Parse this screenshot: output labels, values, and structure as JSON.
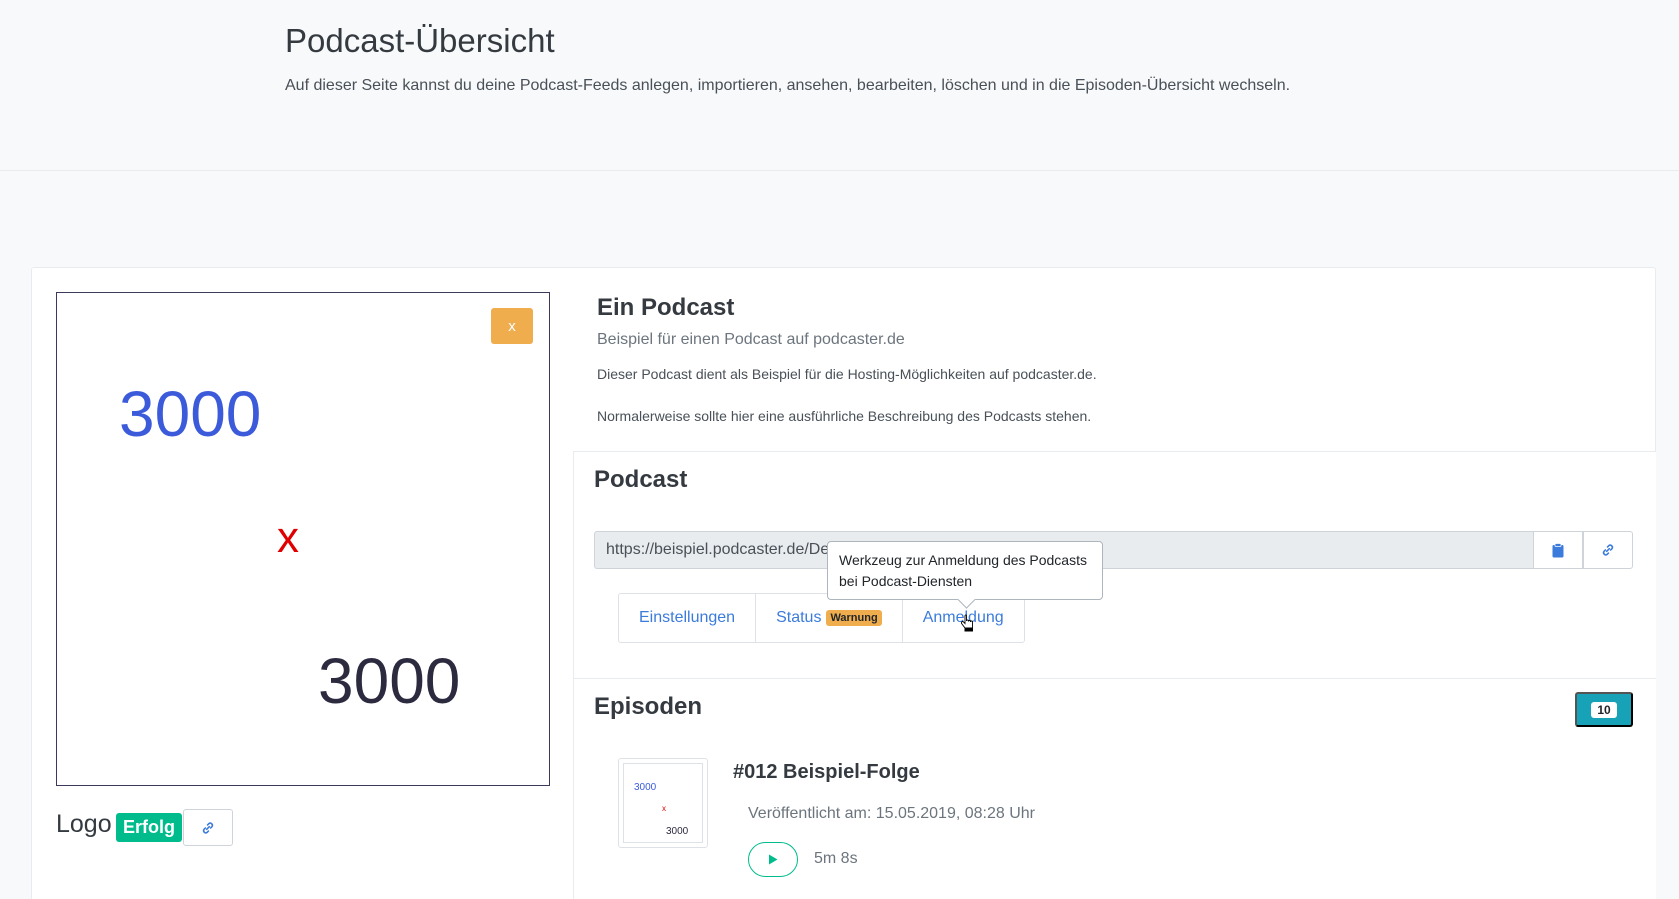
{
  "page": {
    "title": "Podcast-Übersicht",
    "lead": "Auf dieser Seite kannst du deine Podcast-Feeds anlegen, importieren, ansehen, bearbeiten, löschen und in die Episoden-Übersicht wechseln."
  },
  "logo": {
    "remove_label": "x",
    "placeholder_top": "3000",
    "placeholder_mid": "x",
    "placeholder_bottom": "3000",
    "label": "Logo",
    "status": "Erfolg",
    "link_icon": "link-icon"
  },
  "podcast": {
    "name": "Ein Podcast",
    "subtitle": "Beispiel für einen Podcast auf podcaster.de",
    "description_1": "Dieser Podcast dient als Beispiel für die Hosting-Möglichkeiten auf podcaster.de.",
    "description_2": "Normalerweise sollte hier eine ausführliche Beschreibung des Podcasts stehen."
  },
  "feed": {
    "section_title": "Podcast",
    "url": "https://beispiel.podcaster.de/De",
    "copy_icon": "clipboard-icon",
    "open_icon": "link-icon",
    "tooltip": "Werkzeug zur Anmeldung des Podcasts bei Podcast-Diensten",
    "tabs": [
      {
        "label": "Einstellungen"
      },
      {
        "label": "Status",
        "badge": "Warnung"
      },
      {
        "label": "Anmeldung"
      }
    ]
  },
  "episodes": {
    "section_title": "Episoden",
    "count": "10",
    "items": [
      {
        "title": "#012 Beispiel-Folge",
        "published": "Veröffentlicht am: 15.05.2019, 08:28 Uhr",
        "duration": "5m 8s",
        "thumb_top": "3000",
        "thumb_mid": "x",
        "thumb_bottom": "3000"
      }
    ]
  },
  "colors": {
    "success": "#00bc8c",
    "warning": "#f0ad4e",
    "info": "#17a2b8",
    "link": "#3b7bdb"
  }
}
